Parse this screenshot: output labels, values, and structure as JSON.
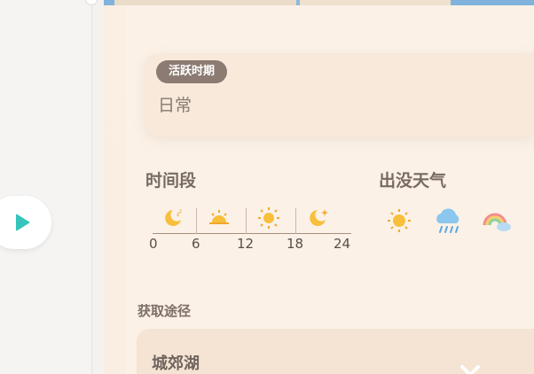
{
  "active_period": {
    "badge_label": "活跃时期",
    "value": "日常"
  },
  "time_section": {
    "title": "时间段",
    "ticks": [
      "0",
      "6",
      "12",
      "18",
      "24"
    ],
    "segments": [
      "moon-sleep-icon",
      "sunrise-icon",
      "sun-icon",
      "moon-star-icon"
    ]
  },
  "weather_section": {
    "title": "出没天气",
    "icons": [
      "sunny-icon",
      "rain-cloud-icon",
      "rainbow-icon"
    ]
  },
  "acquisition": {
    "title": "获取途径",
    "location": "城郊湖"
  },
  "colors": {
    "accent_teal": "#35c4bb",
    "badge_bg": "#8c7b72",
    "panel_bg": "#fbeee2",
    "icon_yellow": "#f7bf3c"
  }
}
